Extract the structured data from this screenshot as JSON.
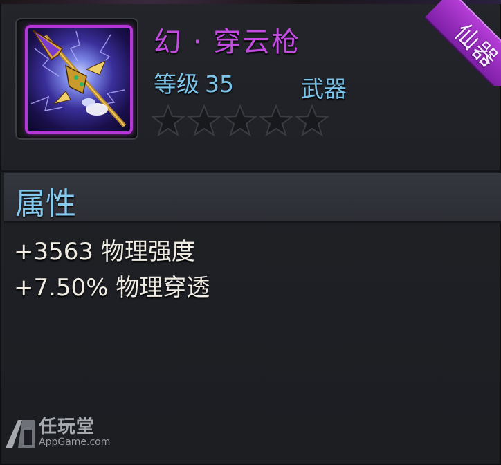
{
  "item": {
    "name": "幻 · 穿云枪",
    "level_label": "等级",
    "level_value": "35",
    "type": "武器",
    "stars_total": 5,
    "stars_filled": 0,
    "icon": "spear-icon",
    "rarity_badge": "仙器"
  },
  "attributes": {
    "header": "属性",
    "lines": [
      "+3563 物理强度",
      "+7.50% 物理穿透"
    ]
  },
  "watermark": {
    "cn": "任玩堂",
    "en": "AppGame.com"
  },
  "colors": {
    "name": "#c24be0",
    "level": "#7cc4ea",
    "badge": "#a030c8",
    "icon_border": "#b436d6"
  }
}
